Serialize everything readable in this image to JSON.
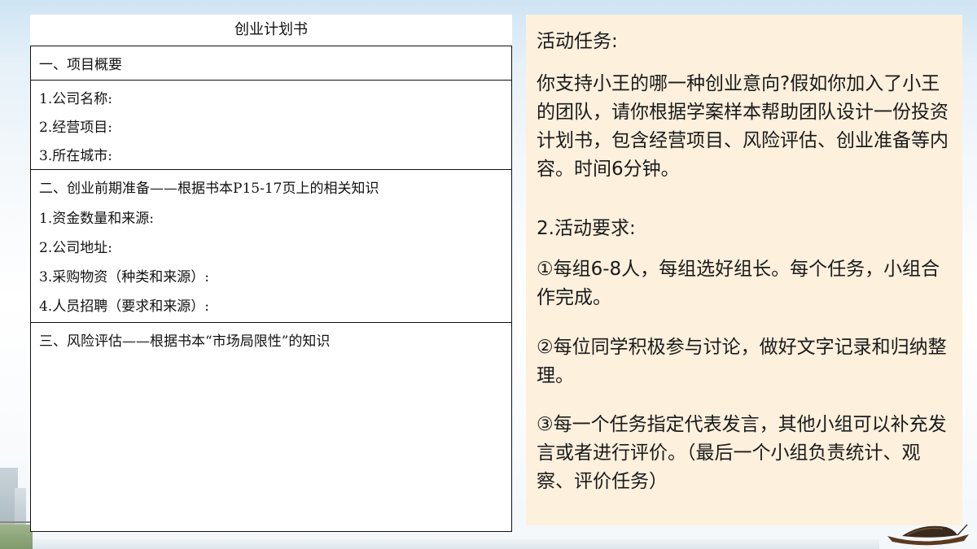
{
  "document": {
    "title": "创业计划书",
    "sections": [
      {
        "heading": "一、项目概要",
        "lines": []
      },
      {
        "heading": "",
        "lines": [
          "1.公司名称:",
          "2.经营项目:",
          "3.所在城市:"
        ]
      },
      {
        "heading": "二、创业前期准备——根据书本P15-17页上的相关知识",
        "lines": [
          "1.资金数量和来源:",
          "2.公司地址:",
          "3.采购物资（种类和来源）:",
          "4.人员招聘（要求和来源）:"
        ]
      },
      {
        "heading": "三、风险评估——根据书本“市场局限性”的知识",
        "lines": []
      }
    ]
  },
  "task": {
    "heading": "活动任务:",
    "intro": "你支持小王的哪一种创业意向?假如你加入了小王的团队，请你根据学案样本帮助团队设计一份投资计划书，包含经营项目、风险评估、创业准备等内容。时间6分钟。",
    "req_heading": "2.活动要求:",
    "requirements": [
      "①每组6-8人，每组选好组长。每个任务，小组合作完成。",
      "②每位同学积极参与讨论，做好文字记录和归纳整理。",
      "③每一个任务指定代表发言，其他小组可以补充发言或者进行评价。（最后一个小组负责统计、观察、评价任务）"
    ]
  }
}
